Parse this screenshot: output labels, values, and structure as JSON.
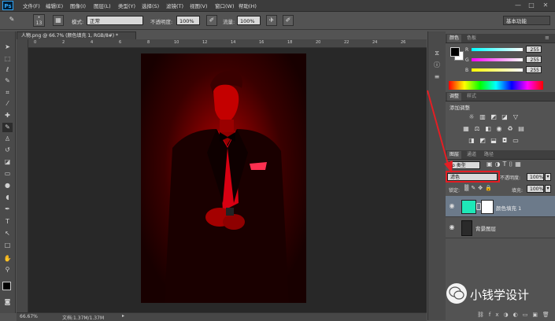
{
  "app": {
    "logo": "Ps"
  },
  "menu": [
    "文件(F)",
    "编辑(E)",
    "图像(I)",
    "图层(L)",
    "类型(Y)",
    "选择(S)",
    "滤镜(T)",
    "视图(V)",
    "窗口(W)",
    "帮助(H)"
  ],
  "window_controls": [
    "—",
    "□",
    "✕"
  ],
  "options_bar": {
    "brush_size": "13",
    "mode_label": "模式:",
    "mode_value": "正常",
    "opacity_label": "不透明度:",
    "opacity_value": "100%",
    "flow_label": "流量:",
    "flow_value": "100%",
    "workspace": "基本功能"
  },
  "document": {
    "tab_title": "人物.png @ 66.7% (颜色填充 1, RGB/8#) *",
    "zoom": "66.67%",
    "doc_info": "文档:1.37M/1.37M",
    "ruler_marks": [
      "0",
      "2",
      "4",
      "6",
      "8",
      "10",
      "12",
      "14",
      "16",
      "18",
      "20",
      "22",
      "24",
      "26"
    ]
  },
  "tools": [
    "move",
    "marquee",
    "lasso",
    "quick-select",
    "crop",
    "eyedropper",
    "spot-heal",
    "brush",
    "clone-stamp",
    "history-brush",
    "eraser",
    "gradient",
    "blur",
    "dodge",
    "pen",
    "type",
    "path-select",
    "rectangle",
    "hand",
    "zoom"
  ],
  "color_panel": {
    "tabs": [
      "颜色",
      "色板"
    ],
    "channels": [
      {
        "label": "R",
        "value": "255"
      },
      {
        "label": "G",
        "value": "255"
      },
      {
        "label": "B",
        "value": "255"
      }
    ],
    "colors": {
      "r": "#ff0000",
      "g": "#00ff00",
      "b": "#0000ff"
    }
  },
  "adjustments_panel": {
    "tabs": [
      "调整",
      "样式"
    ],
    "title": "添加调整"
  },
  "layers_panel": {
    "tabs": [
      "图层",
      "通道",
      "路径"
    ],
    "filter_label": "ρ 类型",
    "blend_mode": "滤色",
    "opacity_label": "不透明度:",
    "opacity_value": "100%",
    "lock_label": "锁定:",
    "fill_label": "填充:",
    "fill_value": "100%",
    "layers": [
      {
        "name": "颜色填充 1",
        "thumb_color": "#1ee8b8",
        "selected": true
      },
      {
        "name": "背景图层",
        "thumb_color": "#2a2a2a",
        "selected": false
      }
    ]
  },
  "watermark": {
    "text": "小钱学设计"
  },
  "colors": {
    "annotation_red": "#e31e24",
    "fill_layer_color": "#1ee8b8"
  }
}
